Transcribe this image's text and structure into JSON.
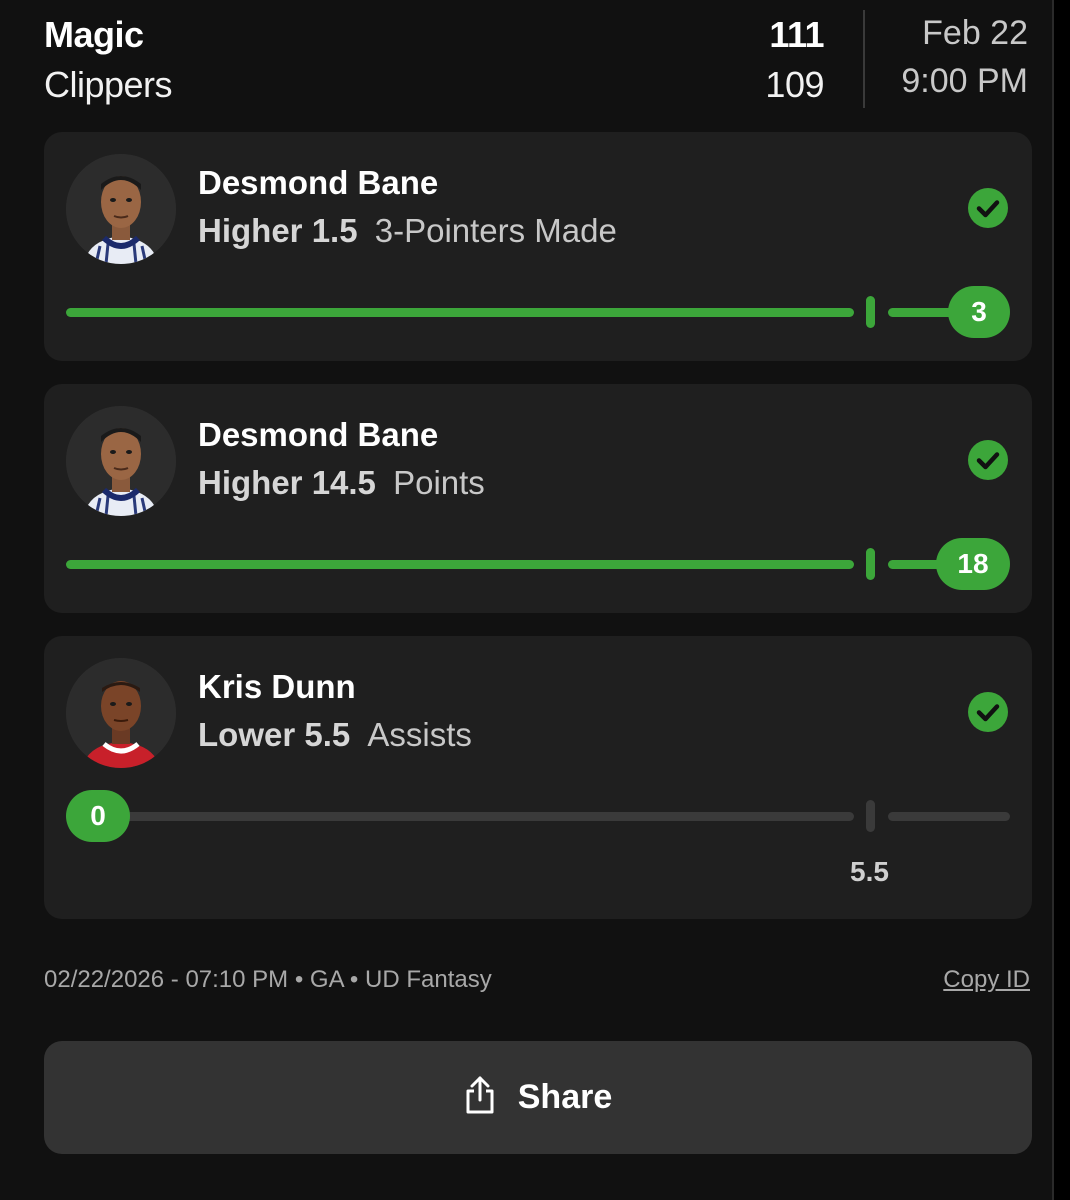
{
  "game": {
    "team_home": "Magic",
    "team_away": "Clippers",
    "score_home": "111",
    "score_away": "109",
    "date": "Feb 22",
    "time": "9:00 PM"
  },
  "picks": [
    {
      "player": "Desmond Bane",
      "direction": "Higher",
      "line": "1.5",
      "stat": "3-Pointers Made",
      "result_value": "3",
      "status": "won",
      "progress": 1.0,
      "line_label": ""
    },
    {
      "player": "Desmond Bane",
      "direction": "Higher",
      "line": "14.5",
      "stat": "Points",
      "result_value": "18",
      "status": "won",
      "progress": 1.0,
      "line_label": ""
    },
    {
      "player": "Kris Dunn",
      "direction": "Lower",
      "line": "5.5",
      "stat": "Assists",
      "result_value": "0",
      "status": "won",
      "progress": 0.0,
      "line_label": "5.5"
    }
  ],
  "footer": {
    "meta": "02/22/2026 - 07:10 PM • GA • UD Fantasy",
    "copy_id": "Copy ID",
    "share_label": "Share"
  },
  "colors": {
    "accent_green": "#3ca63a",
    "card_bg": "#1f1f1f",
    "panel_bg": "#111111",
    "track_empty": "#3a3a3a"
  },
  "icons": {
    "status": "check-circle-icon",
    "share": "share-icon"
  }
}
